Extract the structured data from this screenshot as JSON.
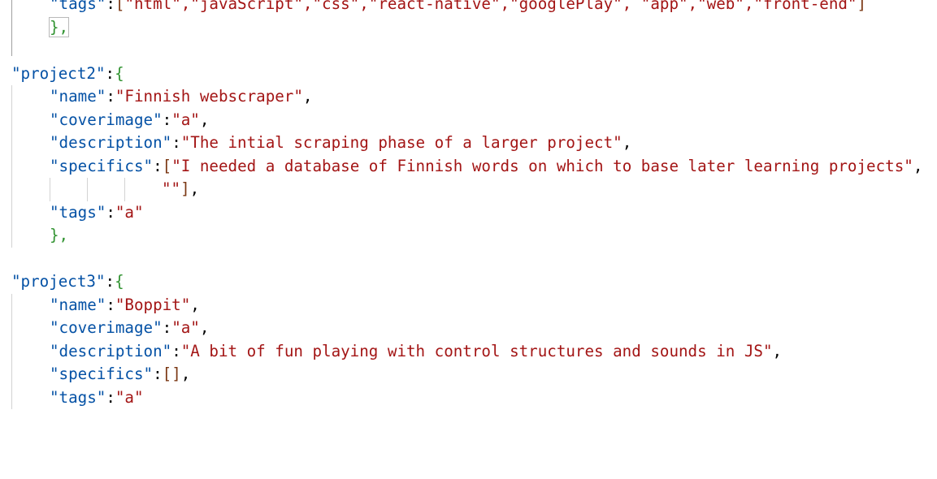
{
  "editor": {
    "tags_prev": {
      "key": "\"tags\"",
      "colon": ":",
      "open": "[",
      "items": "\"html\",\"javaScript\",\"css\",\"react-native\",\"googlePlay\", \"app\",\"web\",\"front-end\"",
      "close": "]"
    },
    "close_prev": "},",
    "project2": {
      "key": "\"project2\"",
      "colon": ":",
      "open": "{",
      "name_key": "\"name\"",
      "name_val": "\"Finnish webscraper\"",
      "cover_key": "\"coverimage\"",
      "cover_val": "\"a\"",
      "desc_key": "\"description\"",
      "desc_val": "\"The intial scraping phase of a larger project\"",
      "spec_key": "\"specifics\"",
      "spec_open": "[",
      "spec_item1": "\"I needed a database of Finnish words on which to base later learning projects\"",
      "spec_item2": "\"\"",
      "spec_close": "]",
      "tags_key": "\"tags\"",
      "tags_val": "\"a\"",
      "close": "},"
    },
    "project3": {
      "key": "\"project3\"",
      "colon": ":",
      "open": "{",
      "name_key": "\"name\"",
      "name_val": "\"Boppit\"",
      "cover_key": "\"coverimage\"",
      "cover_val": "\"a\"",
      "desc_key": "\"description\"",
      "desc_val": "\"A bit of fun playing with control structures and sounds in JS\"",
      "spec_key": "\"specifics\"",
      "spec_val": "[]",
      "tags_key": "\"tags\"",
      "tags_val": "\"a\""
    },
    "comma": ",",
    "colon": ":"
  }
}
